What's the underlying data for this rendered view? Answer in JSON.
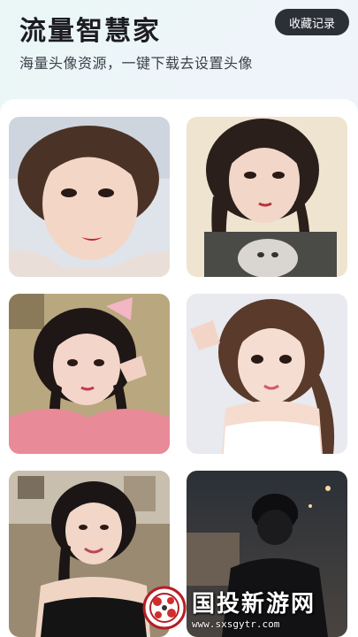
{
  "header": {
    "title": "流量智慧家",
    "subtitle": "海量头像资源，一键下载去设置头像",
    "favorites_button": "收藏记录"
  },
  "gallery": {
    "items": [
      {
        "label": "avatar-photo-1"
      },
      {
        "label": "avatar-photo-2"
      },
      {
        "label": "avatar-photo-3"
      },
      {
        "label": "avatar-photo-4"
      },
      {
        "label": "avatar-photo-5"
      },
      {
        "label": "avatar-photo-6"
      }
    ]
  },
  "watermark": {
    "name": "国投新游网",
    "url": "www.sxsgytr.com"
  },
  "colors": {
    "header_bg": "#eaf7f6",
    "button_bg": "#2b2f36",
    "title": "#1c1c22"
  }
}
